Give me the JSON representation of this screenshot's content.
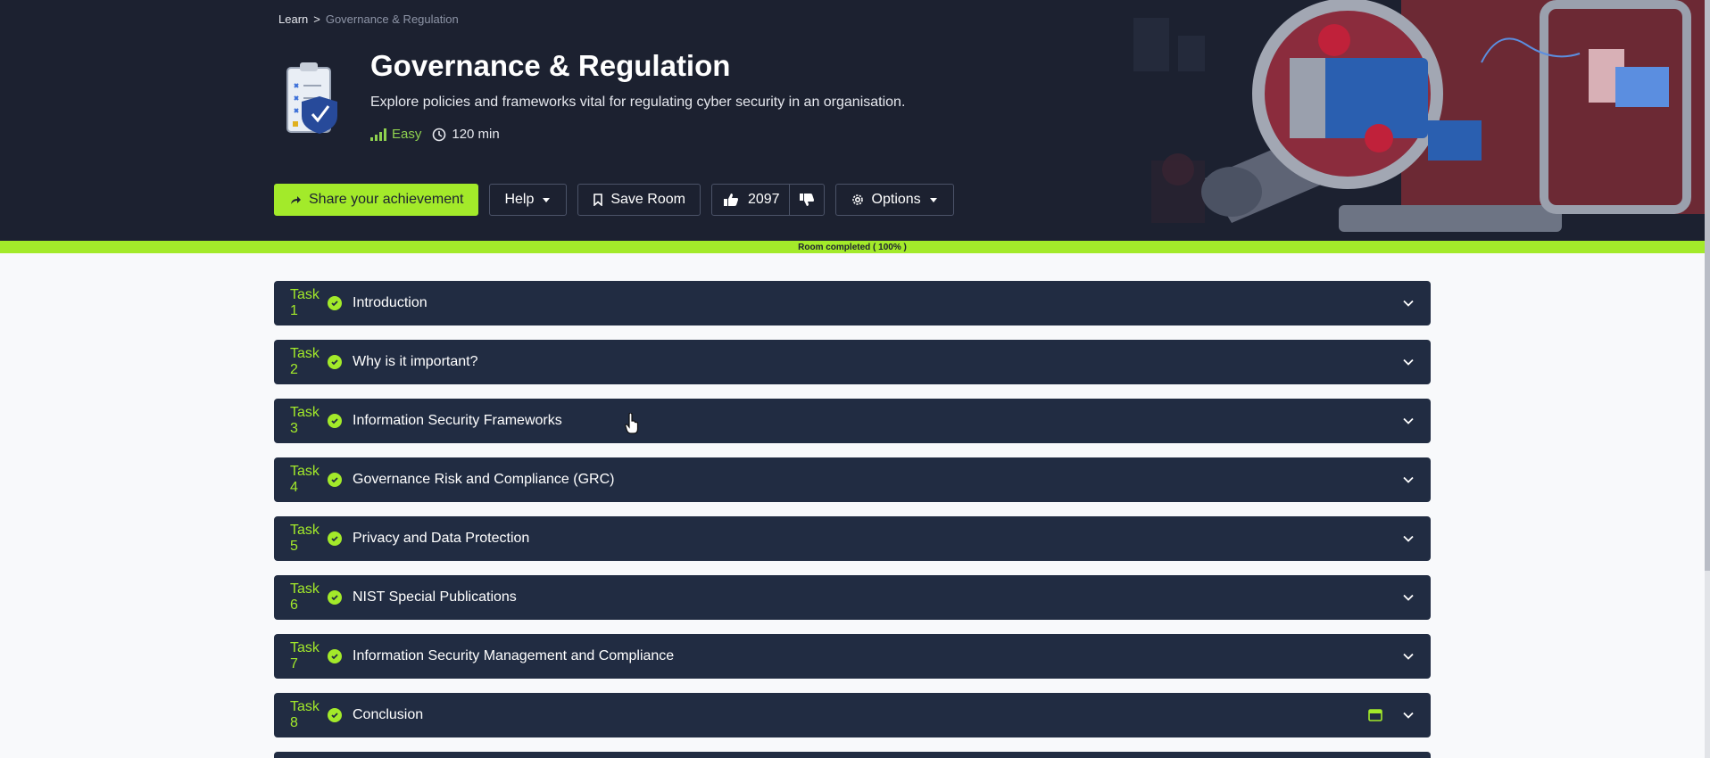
{
  "breadcrumb": {
    "root": "Learn",
    "separator": ">",
    "current": "Governance & Regulation"
  },
  "room": {
    "title": "Governance & Regulation",
    "description": "Explore policies and frameworks vital for regulating cyber security in an organisation.",
    "difficulty": "Easy",
    "duration": "120 min"
  },
  "actions": {
    "share_label": "Share your achievement",
    "help_label": "Help",
    "save_label": "Save Room",
    "upvotes": "2097",
    "options_label": "Options"
  },
  "progress": {
    "label": "Room completed ( 100% )",
    "percent": 100
  },
  "tasks": [
    {
      "num": "Task 1",
      "title": "Introduction"
    },
    {
      "num": "Task 2",
      "title": "Why is it important?"
    },
    {
      "num": "Task 3",
      "title": "Information Security Frameworks"
    },
    {
      "num": "Task 4",
      "title": "Governance Risk and Compliance (GRC)"
    },
    {
      "num": "Task 5",
      "title": "Privacy and Data Protection"
    },
    {
      "num": "Task 6",
      "title": "NIST Special Publications"
    },
    {
      "num": "Task 7",
      "title": "Information Security Management and Compliance"
    },
    {
      "num": "Task 8",
      "title": "Conclusion"
    }
  ],
  "colors": {
    "accent": "#a3ea2a",
    "hero_bg": "#1c2130",
    "task_bg": "#212c42",
    "page_bg": "#f8f9fb"
  }
}
